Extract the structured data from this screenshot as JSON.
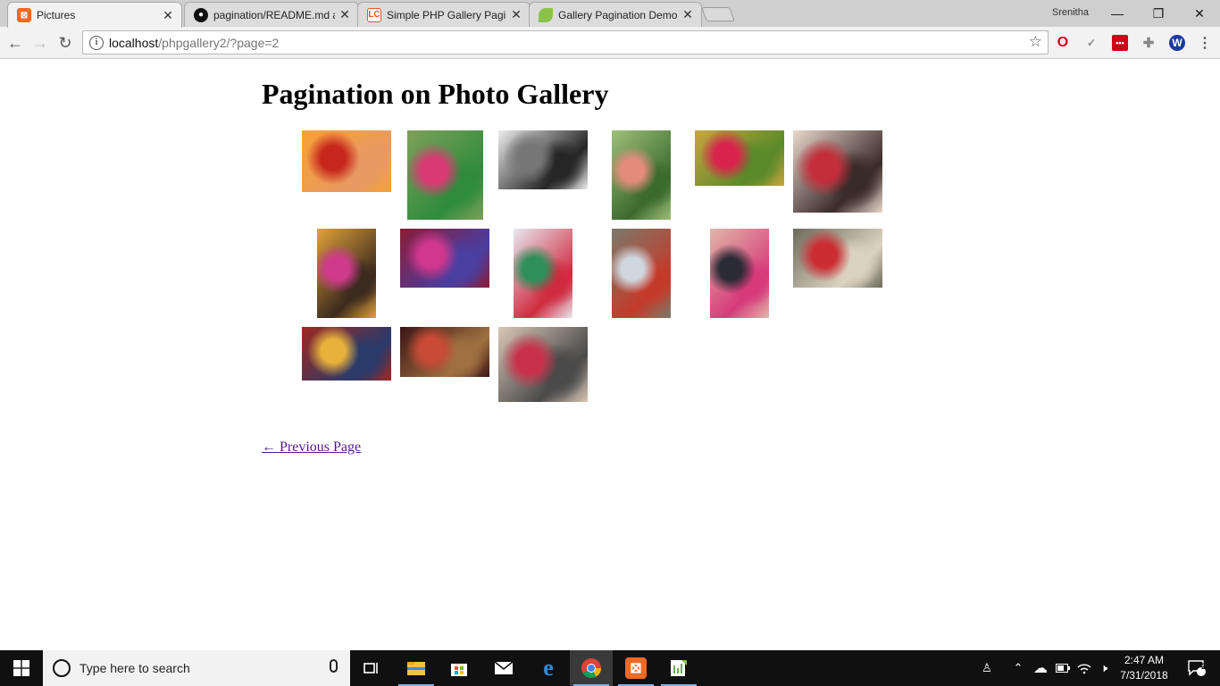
{
  "browser": {
    "tabs": [
      {
        "title": "Pictures",
        "favicon": "xampp-icon",
        "color": "#f06a24",
        "active": true
      },
      {
        "title": "pagination/README.md a",
        "favicon": "github-icon",
        "color": "#111111",
        "active": false
      },
      {
        "title": "Simple PHP Gallery Pagin",
        "favicon": "lc-icon",
        "color": "#e8562a",
        "active": false
      },
      {
        "title": "Gallery Pagination Demo",
        "favicon": "leaf-icon",
        "color": "#8bc34a",
        "active": false
      }
    ],
    "profile_name": "Srenitha",
    "url_host": "localhost",
    "url_path": "/phpgallery2/?page=2"
  },
  "page": {
    "heading": "Pagination on Photo Gallery",
    "prev_link": "← Previous Page",
    "photos": [
      {
        "alt": "hands-mehndi",
        "colors": [
          "#f7a233",
          "#c7261d",
          "#e89a63"
        ]
      },
      {
        "alt": "couple-on-bench",
        "colors": [
          "#7ea05a",
          "#d93a74",
          "#2e8c3c"
        ]
      },
      {
        "alt": "black-white-couple",
        "colors": [
          "#ececec",
          "#777777",
          "#262626"
        ]
      },
      {
        "alt": "couple-green-field",
        "colors": [
          "#9fc07a",
          "#e48b7d",
          "#3b6a2e"
        ]
      },
      {
        "alt": "bride-colorful-bokeh",
        "colors": [
          "#c8a53e",
          "#d8244d",
          "#5a8a2a"
        ]
      },
      {
        "alt": "couple-embrace",
        "colors": [
          "#e9d8cc",
          "#c42e3a",
          "#3a2b2b"
        ]
      },
      {
        "alt": "couple-chandelier",
        "colors": [
          "#e0a33a",
          "#d03a8c",
          "#3b2a1e"
        ]
      },
      {
        "alt": "bride-twirl-lehenga",
        "colors": [
          "#8a1d35",
          "#d2378e",
          "#4a3ea0"
        ]
      },
      {
        "alt": "couple-wedding-hall",
        "colors": [
          "#e8e8f0",
          "#2e8f5a",
          "#cf2b3f"
        ]
      },
      {
        "alt": "couple-by-tree",
        "colors": [
          "#7b7a6a",
          "#cfd8e0",
          "#c43a2a"
        ]
      },
      {
        "alt": "couple-in-mandap",
        "colors": [
          "#e1b7a8",
          "#2b2b35",
          "#d63a7a"
        ]
      },
      {
        "alt": "couple-laughing",
        "colors": [
          "#6b6b5a",
          "#cc2d33",
          "#dcd2c0"
        ]
      },
      {
        "alt": "indian-wedding-banner",
        "colors": [
          "#a02820",
          "#e8b23a",
          "#2a3a6a"
        ]
      },
      {
        "alt": "couple-dark-red",
        "colors": [
          "#3a1515",
          "#c94a35",
          "#a07040"
        ]
      },
      {
        "alt": "couple-outdoor-seated",
        "colors": [
          "#d9c7b6",
          "#c9314a",
          "#4a4a4a"
        ]
      }
    ]
  },
  "taskbar": {
    "search_placeholder": "Type here to search",
    "time": "2:47 AM",
    "date": "7/31/2018",
    "notification_count": "2"
  }
}
